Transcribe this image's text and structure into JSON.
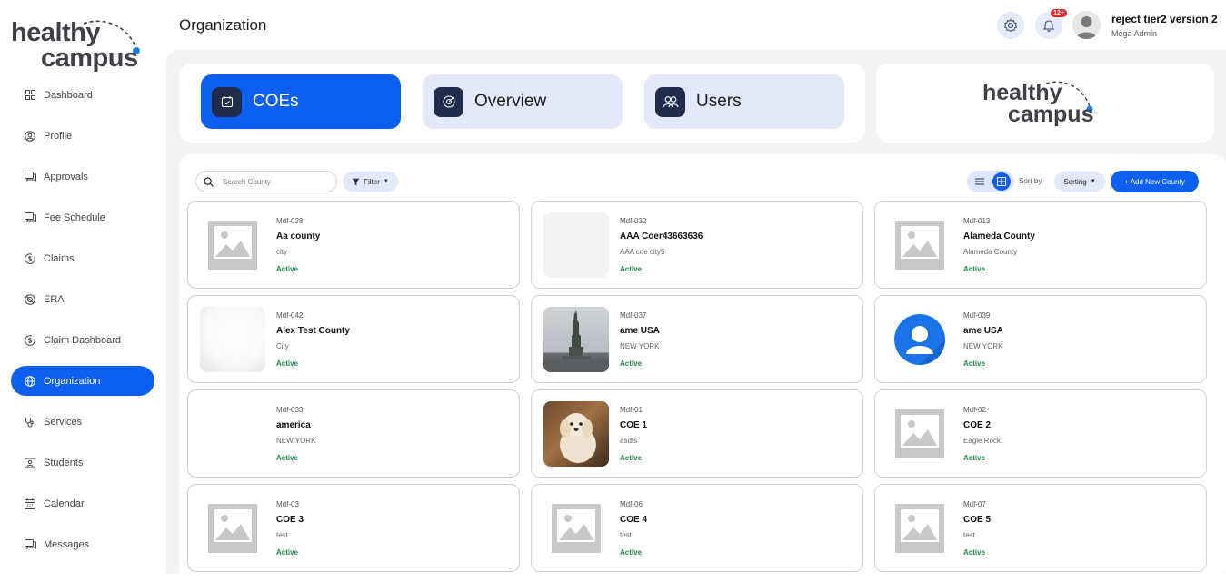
{
  "brand": {
    "line1": "healthy",
    "line2": "campus"
  },
  "sidebar": {
    "items": [
      {
        "label": "Dashboard",
        "icon": "grid-icon",
        "active": false
      },
      {
        "label": "Profile",
        "icon": "user-circle-icon",
        "active": false
      },
      {
        "label": "Approvals",
        "icon": "chat-icon",
        "active": false
      },
      {
        "label": "Fee Schedule",
        "icon": "chat-icon",
        "active": false
      },
      {
        "label": "Claims",
        "icon": "dollar-circle-icon",
        "active": false
      },
      {
        "label": "ERA",
        "icon": "coin-icon",
        "active": false
      },
      {
        "label": "Claim Dashboard",
        "icon": "dollar-circle-icon",
        "active": false
      },
      {
        "label": "Organization",
        "icon": "globe-icon",
        "active": true
      },
      {
        "label": "Services",
        "icon": "stethoscope-icon",
        "active": false
      },
      {
        "label": "Students",
        "icon": "id-card-icon",
        "active": false
      },
      {
        "label": "Calendar",
        "icon": "calendar-icon",
        "active": false
      },
      {
        "label": "Messages",
        "icon": "chat-icon",
        "active": false
      }
    ]
  },
  "header": {
    "title": "Organization",
    "notifications_count": "12+",
    "user_name": "reject tier2 version 2",
    "user_role": "Mega Admin"
  },
  "tabs": [
    {
      "label": "COEs",
      "icon": "calendar-check-icon",
      "active": true
    },
    {
      "label": "Overview",
      "icon": "target-icon",
      "active": false
    },
    {
      "label": "Users",
      "icon": "users-icon",
      "active": false
    }
  ],
  "toolbar": {
    "search_placeholder": "Search County",
    "filter_label": "Filter",
    "sort_by_label": "Sort by",
    "sort_value": "Sorting",
    "add_label": "+ Add New County"
  },
  "cards": [
    {
      "code": "Mdf-028",
      "name": "Aa county",
      "city": "city",
      "status": "Active",
      "thumb": "placeholder"
    },
    {
      "code": "Mdf-032",
      "name": "AAA Coer43663636",
      "city": "AAA coe city5",
      "status": "Active",
      "thumb": "blank"
    },
    {
      "code": "Mdf-013",
      "name": "Alameda County",
      "city": "Alameda County",
      "status": "Active",
      "thumb": "placeholder"
    },
    {
      "code": "Mdf-042",
      "name": "Alex Test County",
      "city": "City",
      "status": "Active",
      "thumb": "soft"
    },
    {
      "code": "Mdf-037",
      "name": "ame USA",
      "city": "NEW YORK",
      "status": "Active",
      "thumb": "statue"
    },
    {
      "code": "Mdf-039",
      "name": "ame USA",
      "city": "NEW YORK",
      "status": "Active",
      "thumb": "avatar"
    },
    {
      "code": "Mdf-033",
      "name": "america",
      "city": "NEW YORK",
      "status": "Active",
      "thumb": "none"
    },
    {
      "code": "Mdf-01",
      "name": "COE 1",
      "city": "asdfs",
      "status": "Active",
      "thumb": "dog"
    },
    {
      "code": "Mdf-02",
      "name": "COE 2",
      "city": "Eagle Rock",
      "status": "Active",
      "thumb": "placeholder"
    },
    {
      "code": "Mdf-03",
      "name": "COE 3",
      "city": "test",
      "status": "Active",
      "thumb": "placeholder"
    },
    {
      "code": "Mdf-06",
      "name": "COE 4",
      "city": "test",
      "status": "Active",
      "thumb": "placeholder"
    },
    {
      "code": "Mdf-07",
      "name": "COE 5",
      "city": "test",
      "status": "Active",
      "thumb": "placeholder"
    }
  ],
  "colors": {
    "accent": "#0d5ff0",
    "status_active": "#1f8a4c",
    "tab_bg": "#e3e8fb"
  }
}
